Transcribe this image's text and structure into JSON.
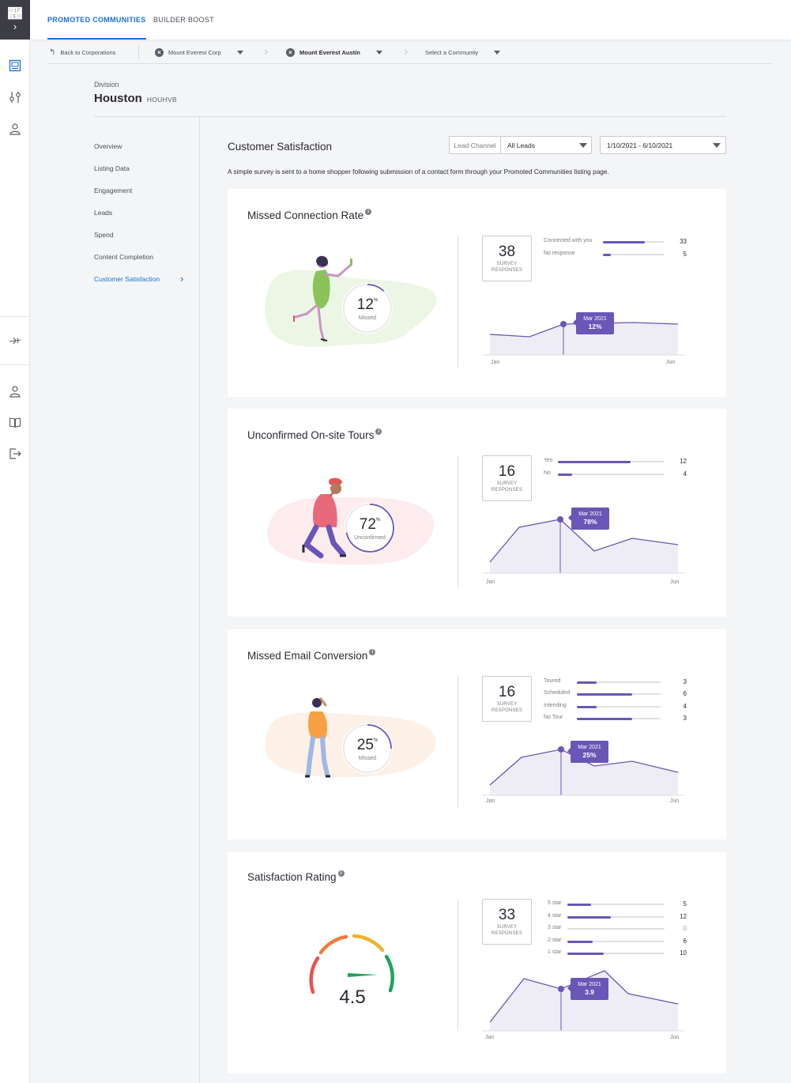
{
  "nav": {
    "tabs": [
      {
        "label": "PROMOTED COMMUNITIES",
        "active": true
      },
      {
        "label": "BUILDER BOOST",
        "active": false
      }
    ]
  },
  "breadcrumbs": {
    "back": "Back to Corporations",
    "corp": "Mount Everest Corp",
    "division": "Mount Everest Austin",
    "community_placeholder": "Select a Community"
  },
  "header": {
    "division_label": "Division",
    "division_name": "Houston",
    "division_code": "HOUHVB"
  },
  "menu": {
    "items": [
      "Overview",
      "Listing Data",
      "Engagement",
      "Leads",
      "Spend",
      "Content Completion",
      "Customer Satisfaction"
    ],
    "active_index": 6
  },
  "section": {
    "title": "Customer Satisfaction",
    "description": "A simple survey is sent to a home shopper following submission of a contact form through your Promoted Communities listing page.",
    "lead_channel_label": "Lead Channel",
    "lead_channel_value": "All Leads",
    "date_range": "1/10/2021 - 6/10/2021"
  },
  "colors": {
    "accent": "#6a56b6",
    "link": "#1a6fd8"
  },
  "cards": [
    {
      "title": "Missed Connection Rate",
      "percent": "12",
      "percent_symbol": "%",
      "percent_label": "Missed",
      "responses": "38",
      "responses_label": "SURVEY RESPONSES",
      "breakdown": [
        {
          "label": "Connected with you",
          "count": 33,
          "fraction": 0.68
        },
        {
          "label": "No response",
          "count": 5,
          "fraction": 0.13
        }
      ],
      "tooltip": {
        "month": "Mar 2021",
        "value": "12%"
      },
      "x_start": "Jan",
      "x_end": "Jun"
    },
    {
      "title": "Unconfirmed On-site Tours",
      "percent": "72",
      "percent_symbol": "%",
      "percent_label": "Unconfirmed",
      "responses": "16",
      "responses_label": "SURVEY RESPONSES",
      "breakdown": [
        {
          "label": "Yes",
          "count": 12,
          "fraction": 0.68
        },
        {
          "label": "No",
          "count": 4,
          "fraction": 0.13
        }
      ],
      "tooltip": {
        "month": "Mar 2021",
        "value": "78%"
      },
      "x_start": "Jan",
      "x_end": "Jun"
    },
    {
      "title": "Missed Email Conversion",
      "percent": "25",
      "percent_symbol": "%",
      "percent_label": "Missed",
      "responses": "16",
      "responses_label": "SURVEY RESPONSES",
      "breakdown": [
        {
          "label": "Toured",
          "count": 3,
          "fraction": 0.24
        },
        {
          "label": "Scheduled",
          "count": 6,
          "fraction": 0.66
        },
        {
          "label": "Intending",
          "count": 4,
          "fraction": 0.24
        },
        {
          "label": "No Tour",
          "count": 3,
          "fraction": 0.66
        }
      ],
      "tooltip": {
        "month": "Mar 2021",
        "value": "25%"
      },
      "x_start": "Jan",
      "x_end": "Jun"
    },
    {
      "title": "Satisfaction Rating",
      "rating": "4.5",
      "responses": "33",
      "responses_label": "SURVEY RESPONSES",
      "breakdown": [
        {
          "label": "5 star",
          "count": 5,
          "fraction": 0.24
        },
        {
          "label": "4 star",
          "count": 12,
          "fraction": 0.45
        },
        {
          "label": "3 star",
          "count": 0,
          "fraction": 0
        },
        {
          "label": "2 star",
          "count": 6,
          "fraction": 0.26
        },
        {
          "label": "1 star",
          "count": 10,
          "fraction": 0.37
        }
      ],
      "tooltip": {
        "month": "Mar 2021",
        "value": "3.9"
      },
      "x_start": "Jan",
      "x_end": "Jun"
    }
  ]
}
